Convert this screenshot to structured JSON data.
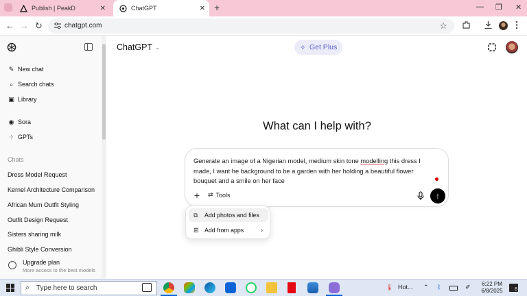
{
  "browser": {
    "tabs": [
      {
        "title": "Publish | PeakD",
        "close": "✕"
      },
      {
        "title": "ChatGPT",
        "close": "✕"
      }
    ],
    "new_tab": "+",
    "window_controls": {
      "minimize": "—",
      "maximize": "❐",
      "close": "✕"
    },
    "url": "chatgpt.com",
    "nav": {
      "back": "←",
      "forward": "→",
      "reload": "↻"
    },
    "bookmark_icon": "☆"
  },
  "sidebar": {
    "items": [
      {
        "label": "New chat",
        "icon": "edit-icon",
        "glyph": "✎"
      },
      {
        "label": "Search chats",
        "icon": "search-icon",
        "glyph": "⌕"
      },
      {
        "label": "Library",
        "icon": "library-icon",
        "glyph": "▣"
      },
      {
        "label": "Sora",
        "icon": "sora-icon",
        "glyph": "◉"
      },
      {
        "label": "GPTs",
        "icon": "gpts-icon",
        "glyph": "⁘"
      }
    ],
    "chats_heading": "Chats",
    "chats": [
      "Dress Model Request",
      "Kernel Architecture Comparison",
      "African Mum Outfit Styling",
      "Outfit Design Request",
      "Sisters sharing milk",
      "Ghibli Style Conversion"
    ],
    "upgrade": {
      "title": "Upgrade plan",
      "subtitle": "More access to the best models"
    }
  },
  "header": {
    "model": "ChatGPT",
    "model_chevron": "⌄",
    "get_plus": "Get Plus",
    "get_plus_icon": "✧"
  },
  "main": {
    "headline": "What can I help with?"
  },
  "composer": {
    "text_before": "Generate an image of a Nigerian model, medium skin tone ",
    "text_underlined": "modelling",
    "text_after": " this dress I made, I want he background to be a garden with her holding a beautiful flower bouquet and a smile on her face",
    "plus": "+",
    "tools_label": "Tools",
    "tools_icon": "⇄",
    "send_icon": "↑"
  },
  "popup_menu": {
    "items": [
      {
        "label": "Add photos and files",
        "icon": "attach-icon",
        "glyph": "⧉"
      },
      {
        "label": "Add from apps",
        "icon": "apps-icon",
        "glyph": "⊞",
        "arrow": "›"
      }
    ]
  },
  "taskbar": {
    "search_placeholder": "Type here to search",
    "weather": "Hot...",
    "time": "6:22 PM",
    "date": "6/8/2025",
    "notifications": "8"
  },
  "colors": {
    "tabbar": "#f7c9d6",
    "accent_plus": "#5b5fc7",
    "send": "#000000",
    "taskbar": "#dfe7f4"
  }
}
